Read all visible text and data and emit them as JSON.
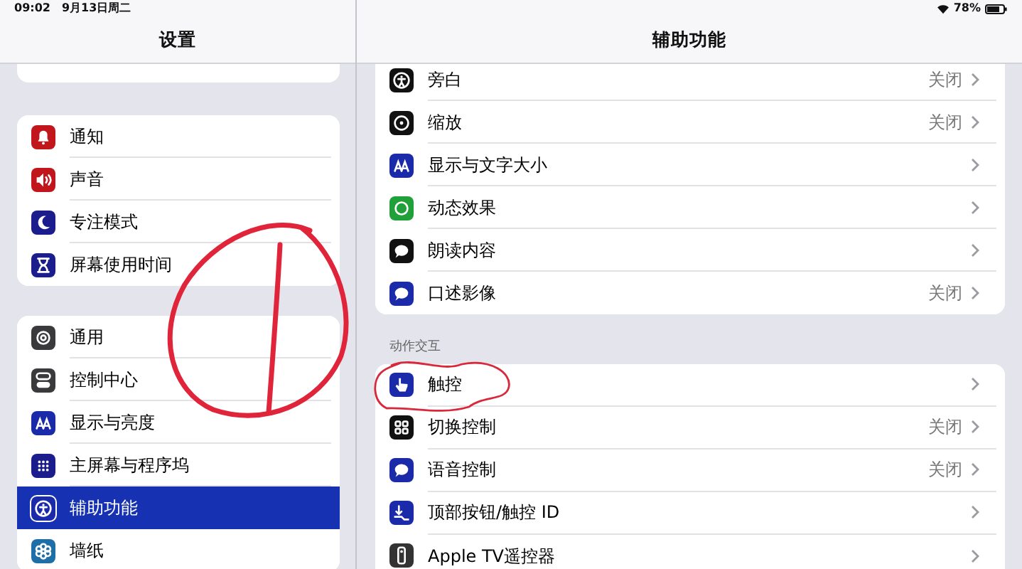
{
  "status_bar": {
    "time": "09:02",
    "date": "9月13日周二",
    "battery": "78%"
  },
  "sidebar": {
    "title": "设置",
    "groups": [
      {
        "items": [
          {
            "label": "通知",
            "color": "#c0161c",
            "selected": false
          },
          {
            "label": "声音",
            "color": "#c0161c",
            "selected": false
          },
          {
            "label": "专注模式",
            "color": "#1c1d8c",
            "selected": false
          },
          {
            "label": "屏幕使用时间",
            "color": "#1c1d8c",
            "selected": false
          }
        ]
      },
      {
        "items": [
          {
            "label": "通用",
            "color": "#3a3a3c",
            "selected": false
          },
          {
            "label": "控制中心",
            "color": "#3a3a3c",
            "selected": false
          },
          {
            "label": "显示与亮度",
            "color": "#1a2aa8",
            "selected": false
          },
          {
            "label": "主屏幕与程序坞",
            "color": "#1c1d8c",
            "selected": false
          },
          {
            "label": "辅助功能",
            "color": "#1a2aa8",
            "selected": true
          },
          {
            "label": "墙纸",
            "color": "#1e6fa8",
            "selected": false
          }
        ]
      }
    ]
  },
  "detail": {
    "title": "辅助功能",
    "sections": [
      {
        "items": [
          {
            "label": "旁白",
            "value": "关闭",
            "color": "#111111"
          },
          {
            "label": "缩放",
            "value": "关闭",
            "color": "#111111"
          },
          {
            "label": "显示与文字大小",
            "color": "#1a2aa8"
          },
          {
            "label": "动态效果",
            "color": "#21a03a"
          },
          {
            "label": "朗读内容",
            "color": "#111111"
          },
          {
            "label": "口述影像",
            "value": "关闭",
            "color": "#1a2aa8"
          }
        ]
      },
      {
        "header": "动作交互",
        "items": [
          {
            "label": "触控",
            "color": "#1a2aa8"
          },
          {
            "label": "切换控制",
            "value": "关闭",
            "color": "#111111"
          },
          {
            "label": "语音控制",
            "value": "关闭",
            "color": "#1a2aa8"
          },
          {
            "label": "顶部按钮/触控 ID",
            "color": "#1a2aa8"
          },
          {
            "label": "Apple TV遥控器",
            "color": "#333333"
          }
        ]
      }
    ]
  }
}
